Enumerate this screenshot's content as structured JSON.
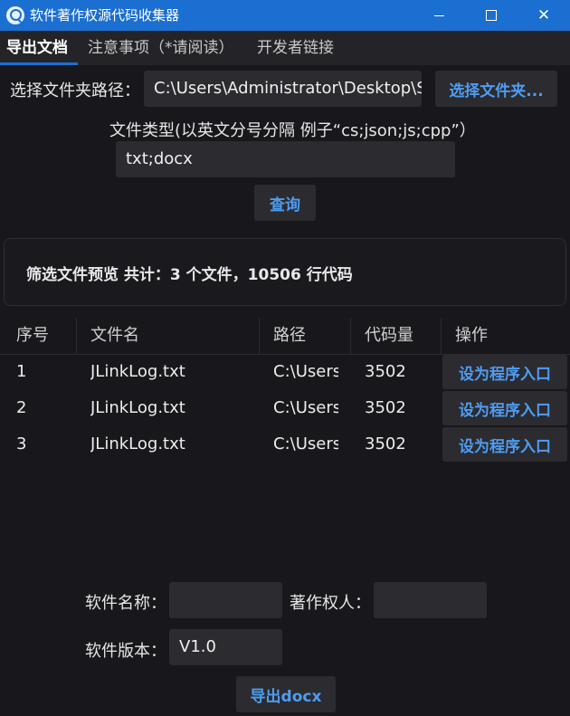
{
  "window": {
    "title": "软件著作权源代码收集器",
    "icon": "search-icon",
    "controls": {
      "minimize": "minimize-icon",
      "maximize": "maximize-icon",
      "close": "✕"
    }
  },
  "tabs": [
    {
      "label": "导出文档",
      "active": true
    },
    {
      "label": "注意事项（*请阅读）",
      "active": false
    },
    {
      "label": "开发者链接",
      "active": false
    }
  ],
  "folder": {
    "label": "选择文件夹路径：",
    "value": "C:\\Users\\Administrator\\Desktop\\S",
    "button": "选择文件夹..."
  },
  "filetype": {
    "label": "文件类型(以英文分号分隔 例子“cs;json;js;cpp”）",
    "value": "txt;docx"
  },
  "query_button": "查询",
  "summary": {
    "text": "筛选文件预览 共计：3 个文件，10506 行代码"
  },
  "table": {
    "columns": [
      "序号",
      "文件名",
      "路径",
      "代码量",
      "操作"
    ],
    "rows": [
      {
        "index": "1",
        "filename": "JLinkLog.txt",
        "path": "C:\\Users'",
        "lines": "3502",
        "action": "设为程序入口"
      },
      {
        "index": "2",
        "filename": "JLinkLog.txt",
        "path": "C:\\Users'",
        "lines": "3502",
        "action": "设为程序入口"
      },
      {
        "index": "3",
        "filename": "JLinkLog.txt",
        "path": "C:\\Users'",
        "lines": "3502",
        "action": "设为程序入口"
      }
    ]
  },
  "form": {
    "software_name_label": "软件名称：",
    "software_name_value": "",
    "owner_label": "著作权人：",
    "owner_value": "",
    "version_label": "软件版本：",
    "version_value": "V1.0",
    "export_button": "导出docx"
  },
  "colors": {
    "titlebar": "#1b6fd1",
    "background": "#18181c",
    "accent_text": "#4f9cf0",
    "input_bg": "#2b2b30"
  }
}
